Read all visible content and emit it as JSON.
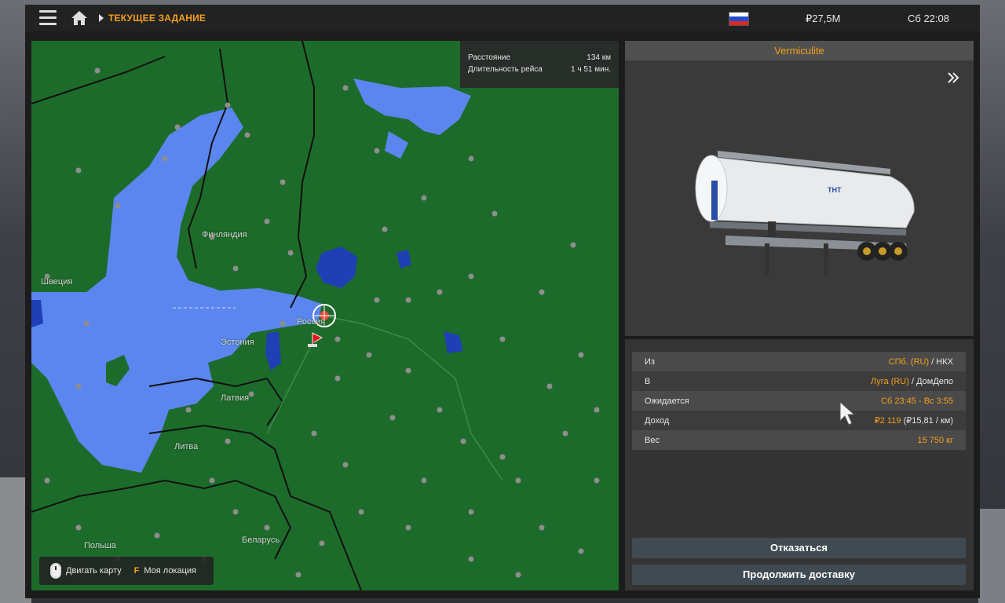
{
  "topbar": {
    "breadcrumb": "ТЕКУЩЕЕ ЗАДАНИЕ",
    "money": "₽27,5M",
    "clock": "Сб 22:08"
  },
  "map": {
    "info": {
      "distance_label": "Расстояние",
      "distance_value": "134 км",
      "duration_label": "Длительность рейса",
      "duration_value": "1 ч 51 мин."
    },
    "labels": {
      "finland": "Финляндия",
      "sweden": "Швеция",
      "estonia": "Эстония",
      "latvia": "Латвия",
      "lithuania": "Литва",
      "poland": "Польша",
      "belarus": "Беларусь",
      "russia": "Россия"
    },
    "controls": {
      "move_map": "Двигать карту",
      "key": "F",
      "my_location": "Моя локация"
    }
  },
  "cargo": {
    "name": "Vermiculite"
  },
  "details": {
    "from_label": "Из",
    "from_city": "СПб. (RU)",
    "from_company": "НКХ",
    "to_label": "В",
    "to_city": "Луга (RU)",
    "to_company": "ДомДепо",
    "expected_label": "Ожидается",
    "expected_value": "Сб 23:45 - Вс 3:55",
    "income_label": "Доход",
    "income_value": "₽2 119",
    "income_rate": "(₽15,81 / км)",
    "weight_label": "Вес",
    "weight_value": "15 750 кг"
  },
  "buttons": {
    "refuse": "Отказаться",
    "continue": "Продолжить доставку"
  },
  "colors": {
    "accent": "#f2a01d",
    "land": "#1d6b2a",
    "water": "#5b86f0"
  }
}
